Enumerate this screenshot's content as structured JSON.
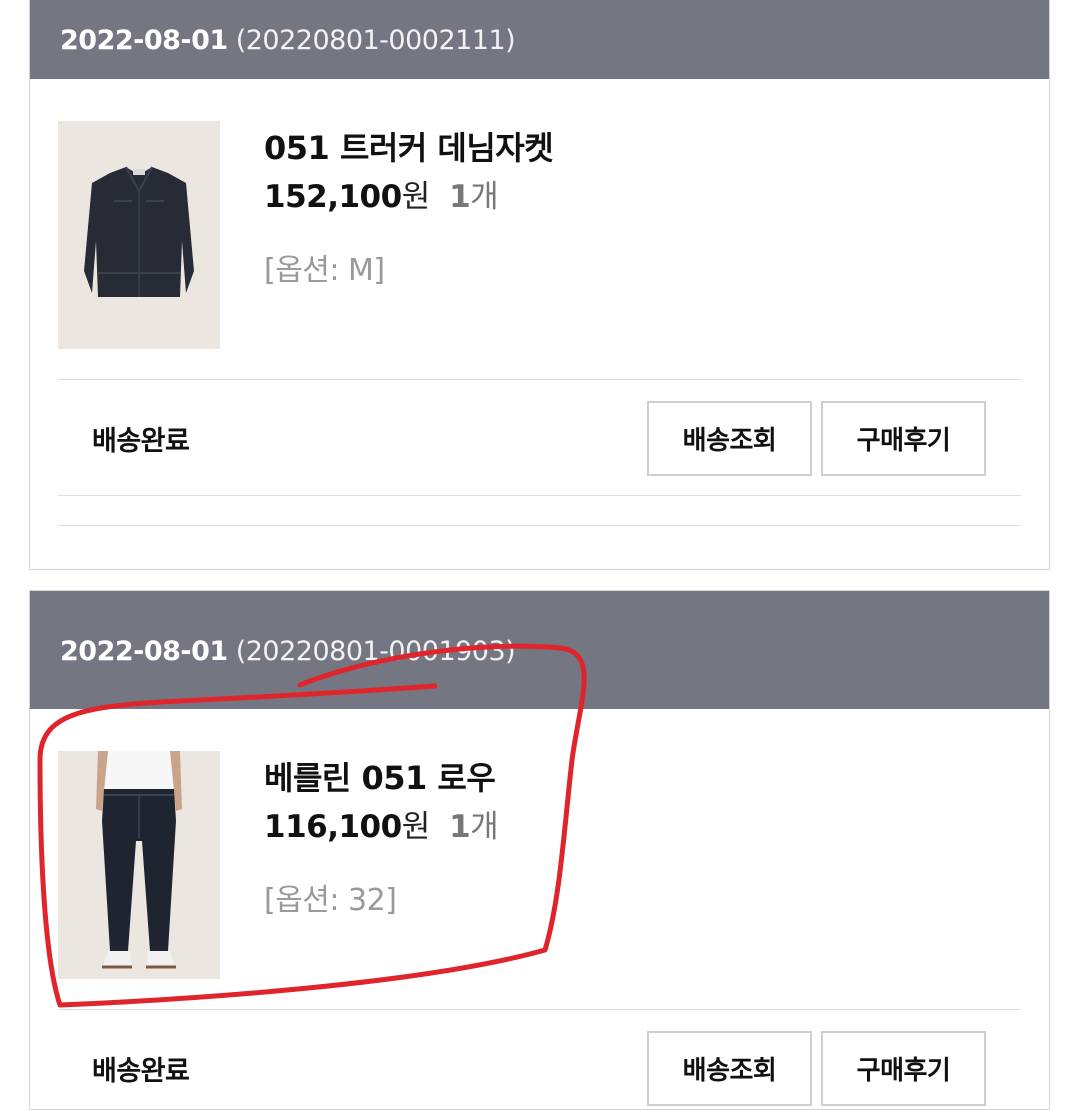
{
  "orders": [
    {
      "date": "2022-08-01",
      "order_no": "(20220801-0002111)",
      "item": {
        "name": "051 트러커 데님자켓",
        "price": "152,100",
        "currency": "원",
        "qty": "1",
        "qty_unit": "개",
        "option": "[옵션: M]"
      },
      "status": "배송완료",
      "buttons": {
        "track": "배송조회",
        "review": "구매후기"
      }
    },
    {
      "date": "2022-08-01",
      "order_no": "(20220801-0001903)",
      "item": {
        "name": "베를린 051 로우",
        "price": "116,100",
        "currency": "원",
        "qty": "1",
        "qty_unit": "개",
        "option": "[옵션: 32]"
      },
      "status": "배송완료",
      "buttons": {
        "track": "배송조회",
        "review": "구매후기"
      }
    }
  ],
  "colors": {
    "header_bg": "#747782",
    "annotation": "#e0242c",
    "border": "#d4d4d8"
  }
}
